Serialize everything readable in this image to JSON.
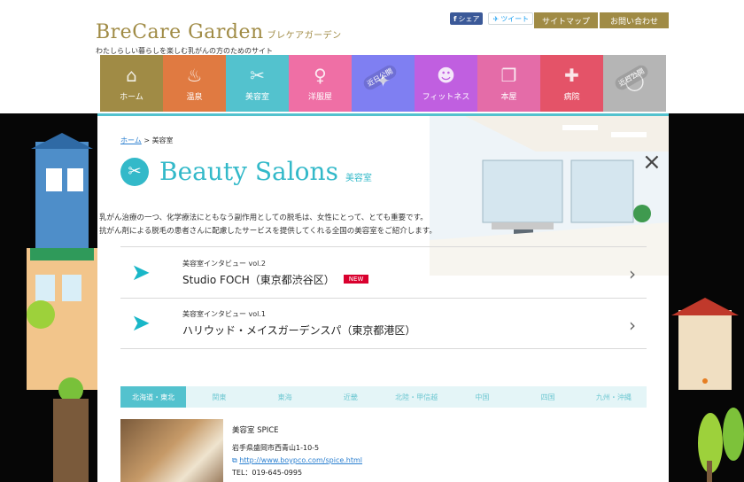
{
  "header": {
    "logo": "BreCare Garden",
    "logo_kana": "ブレケアガーデン",
    "tagline": "わたしらしい暮らしを楽しむ乳がんの方のためのサイト",
    "share_label": "シェア",
    "tweet_label": "ツイート",
    "sitemap_label": "サイトマップ",
    "contact_label": "お問い合わせ"
  },
  "nav": [
    {
      "label": "ホーム",
      "color": "#a08b45",
      "icon": "home-icon",
      "glyph": "⌂"
    },
    {
      "label": "温泉",
      "color": "#e07a41",
      "icon": "hot-spring-icon",
      "glyph": "♨"
    },
    {
      "label": "美容室",
      "color": "#53c2ce",
      "icon": "scissors-icon",
      "glyph": "✂"
    },
    {
      "label": "洋服屋",
      "color": "#ef6fa5",
      "icon": "dress-icon",
      "glyph": "♀"
    },
    {
      "label": "",
      "color": "#7f7ff2",
      "icon": "store-icon",
      "glyph": "✦",
      "soon": "近日公開"
    },
    {
      "label": "フィットネス",
      "color": "#c05fe0",
      "icon": "fitness-icon",
      "glyph": "☻"
    },
    {
      "label": "本屋",
      "color": "#e46ca8",
      "icon": "book-icon",
      "glyph": "❐"
    },
    {
      "label": "病院",
      "color": "#e45368",
      "icon": "hospital-icon",
      "glyph": "✚"
    },
    {
      "label": "",
      "color": "#b5b5b5",
      "icon": "more-icon",
      "glyph": "◯",
      "soon": "近日公開"
    }
  ],
  "main": {
    "breadcrumb_home": "ホーム",
    "breadcrumb_sep": ">",
    "breadcrumb_current": "美容室",
    "title": "Beauty Salons",
    "title_jp": "美容室",
    "intro_line1": "乳がん治療の一つ、化学療法にともなう副作用としての脱毛は、女性にとって、とても重要です。",
    "intro_line2": "抗がん剤による脱毛の患者さんに配慮したサービスを提供してくれる全国の美容室をご紹介します。",
    "interviews": [
      {
        "sub": "美容室インタビュー vol.2",
        "title": "Studio FOCH（東京都渋谷区）",
        "badge": "NEW"
      },
      {
        "sub": "美容室インタビュー vol.1",
        "title": "ハリウッド・メイスガーデンスパ（東京都港区）",
        "badge": ""
      }
    ],
    "regions": [
      "北海道・東北",
      "関東",
      "東海",
      "近畿",
      "北陸・甲信越",
      "中国",
      "四国",
      "九州・沖縄"
    ],
    "listing": {
      "name": "美容室 SPICE",
      "address": "岩手県盛岡市西青山1-10-5",
      "url": "http://www.boypco.com/spice.html",
      "tel": "TEL：019-645-0995"
    }
  }
}
